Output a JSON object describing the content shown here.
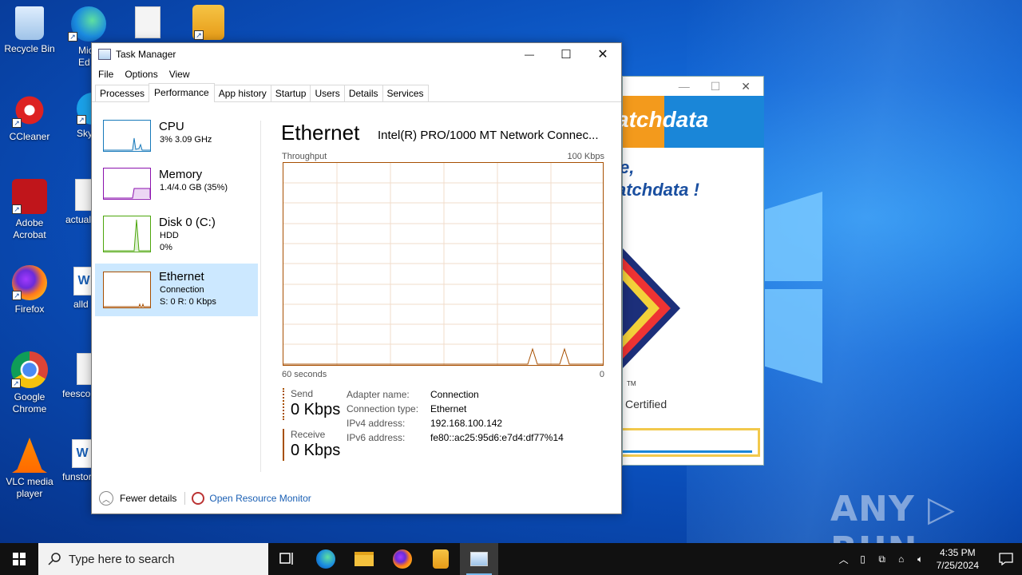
{
  "desktop": {
    "icons": [
      {
        "label": "Recycle Bin"
      },
      {
        "label": "Micro Ed"
      },
      {
        "label": "CCleaner"
      },
      {
        "label": "Sky"
      },
      {
        "label": "Adobe Acrobat"
      },
      {
        "label": "actual"
      },
      {
        "label": "Firefox"
      },
      {
        "label": "alld"
      },
      {
        "label": "Google Chrome"
      },
      {
        "label": "feesco"
      },
      {
        "label": "VLC media player"
      },
      {
        "label": "funstor"
      }
    ]
  },
  "background_window": {
    "banner_text": "atchdata",
    "welcome_line1": "e,",
    "welcome_line2": "atchdata !",
    "trademark": "TM",
    "certified": "Certified",
    "progress": 0.96
  },
  "task_manager": {
    "title": "Task Manager",
    "controls": {
      "minimize": "—",
      "maximize": "☐",
      "close": "✕"
    },
    "menu": [
      "File",
      "Options",
      "View"
    ],
    "tabs": [
      "Processes",
      "Performance",
      "App history",
      "Startup",
      "Users",
      "Details",
      "Services"
    ],
    "active_tab": "Performance",
    "sidebar": [
      {
        "name": "CPU",
        "line1": "3% 3.09 GHz",
        "line2": "",
        "color": "#1779ba"
      },
      {
        "name": "Memory",
        "line1": "1.4/4.0 GB (35%)",
        "line2": "",
        "color": "#8b12ae"
      },
      {
        "name": "Disk 0 (C:)",
        "line1": "HDD",
        "line2": "0%",
        "color": "#4da60c"
      },
      {
        "name": "Ethernet",
        "line1": "Connection",
        "line2": "S: 0 R: 0 Kbps",
        "color": "#a74f01"
      }
    ],
    "detail": {
      "title": "Ethernet",
      "adapter": "Intel(R) PRO/1000 MT Network Connec...",
      "throughput_label": "Throughput",
      "max_label": "100 Kbps",
      "time_left": "60 seconds",
      "time_right": "0",
      "send_label": "Send",
      "send_value": "0 Kbps",
      "receive_label": "Receive",
      "receive_value": "0 Kbps",
      "properties": [
        {
          "key": "Adapter name:",
          "value": "Connection"
        },
        {
          "key": "Connection type:",
          "value": "Ethernet"
        },
        {
          "key": "IPv4 address:",
          "value": "192.168.100.142"
        },
        {
          "key": "IPv6 address:",
          "value": "fe80::ac25:95d6:e7d4:df77%14"
        }
      ]
    },
    "footer": {
      "fewer_details": "Fewer details",
      "open_resource_monitor": "Open Resource Monitor"
    }
  },
  "watermark": "ANY ▷ RUN",
  "taskbar": {
    "search_placeholder": "Type here to search",
    "time": "4:35 PM",
    "date": "7/25/2024"
  }
}
